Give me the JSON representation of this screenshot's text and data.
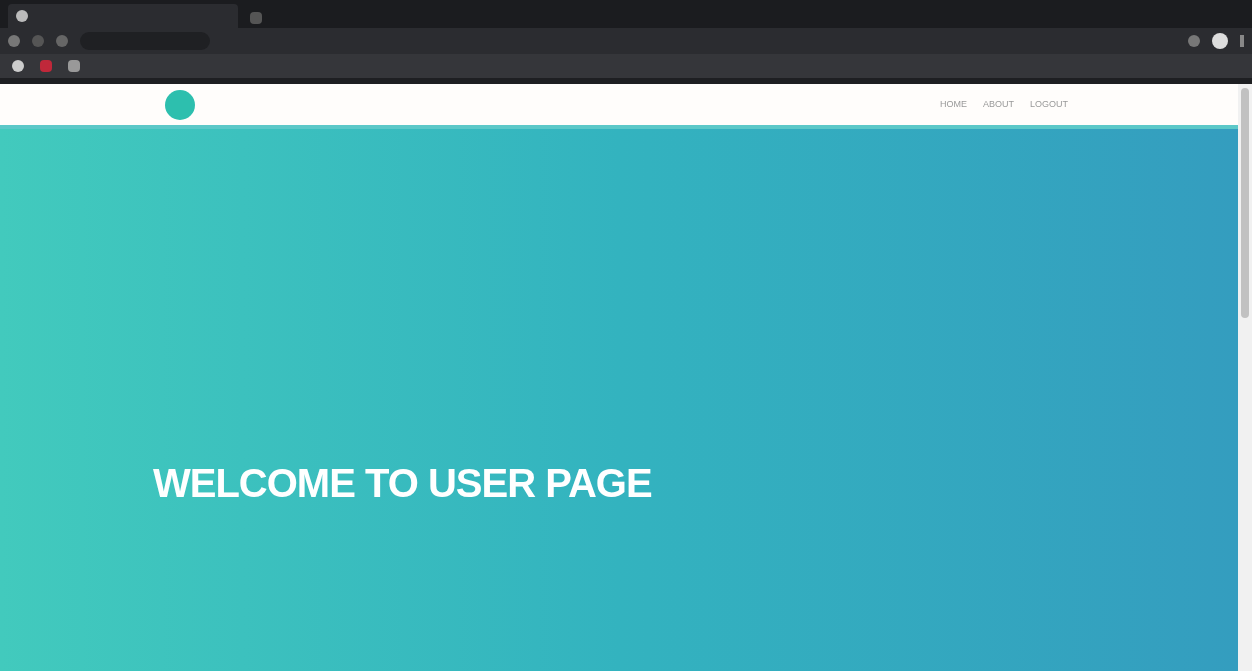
{
  "header": {
    "nav": [
      {
        "label": "HOME"
      },
      {
        "label": "ABOUT"
      },
      {
        "label": "LOGOUT"
      }
    ]
  },
  "hero": {
    "title": "WELCOME TO USER PAGE"
  }
}
